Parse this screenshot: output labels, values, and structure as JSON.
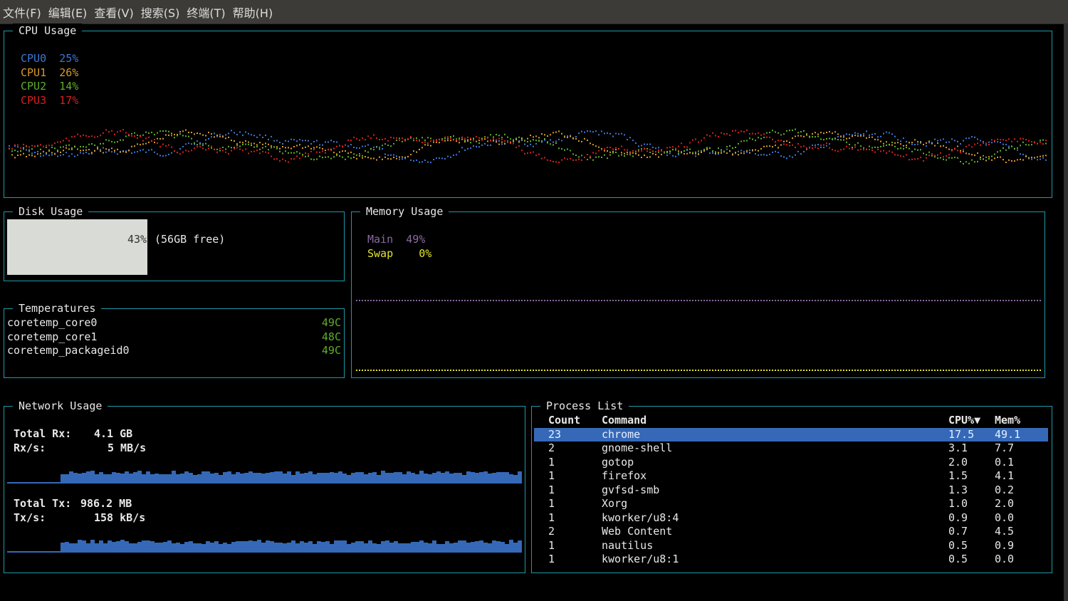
{
  "menu": [
    "文件(F)",
    "编辑(E)",
    "查看(V)",
    "搜索(S)",
    "终端(T)",
    "帮助(H)"
  ],
  "cpu": {
    "title": "CPU Usage",
    "cores": [
      {
        "name": "CPU0",
        "value": "25%",
        "color": "#3c77d4"
      },
      {
        "name": "CPU1",
        "value": "26%",
        "color": "#d89a2a"
      },
      {
        "name": "CPU2",
        "value": "14%",
        "color": "#5fae2a"
      },
      {
        "name": "CPU3",
        "value": "17%",
        "color": "#d42020"
      }
    ]
  },
  "disk": {
    "title": "Disk Usage",
    "percent_label": "43%",
    "free_label": "(56GB free)",
    "fraction": 0.43
  },
  "temps": {
    "title": "Temperatures",
    "items": [
      {
        "name": "coretemp_core0",
        "value": "49C"
      },
      {
        "name": "coretemp_core1",
        "value": "48C"
      },
      {
        "name": "coretemp_packageid0",
        "value": "49C"
      }
    ]
  },
  "memory": {
    "title": "Memory Usage",
    "main_label": "Main",
    "main_value": "49%",
    "swap_label": "Swap",
    "swap_value": "0%",
    "main_color": "#8b6aa0",
    "swap_color": "#e3e32c"
  },
  "network": {
    "title": "Network Usage",
    "rx_total_label": "Total Rx:",
    "rx_total_value": "4.1 GB",
    "rx_rate_label": "Rx/s:",
    "rx_rate_value": "5 MB/s",
    "tx_total_label": "Total Tx:",
    "tx_total_value": "986.2 MB",
    "tx_rate_label": "Tx/s:",
    "tx_rate_value": "158 kB/s",
    "bar_color": "#3569b8"
  },
  "processes": {
    "title": "Process List",
    "headers": {
      "count": "Count",
      "command": "Command",
      "cpu": "CPU%▼",
      "mem": "Mem%"
    },
    "rows": [
      {
        "count": "23",
        "command": "chrome",
        "cpu": "17.5",
        "mem": "49.1"
      },
      {
        "count": "2",
        "command": "gnome-shell",
        "cpu": "3.1",
        "mem": "7.7"
      },
      {
        "count": "1",
        "command": "gotop",
        "cpu": "2.0",
        "mem": "0.1"
      },
      {
        "count": "1",
        "command": "firefox",
        "cpu": "1.5",
        "mem": "4.1"
      },
      {
        "count": "1",
        "command": "gvfsd-smb",
        "cpu": "1.3",
        "mem": "0.2"
      },
      {
        "count": "1",
        "command": "Xorg",
        "cpu": "1.0",
        "mem": "2.0"
      },
      {
        "count": "1",
        "command": "kworker/u8:4",
        "cpu": "0.9",
        "mem": "0.0"
      },
      {
        "count": "2",
        "command": "Web Content",
        "cpu": "0.7",
        "mem": "4.5"
      },
      {
        "count": "1",
        "command": "nautilus",
        "cpu": "0.5",
        "mem": "0.9"
      },
      {
        "count": "1",
        "command": "kworker/u8:1",
        "cpu": "0.5",
        "mem": "0.0"
      }
    ]
  }
}
